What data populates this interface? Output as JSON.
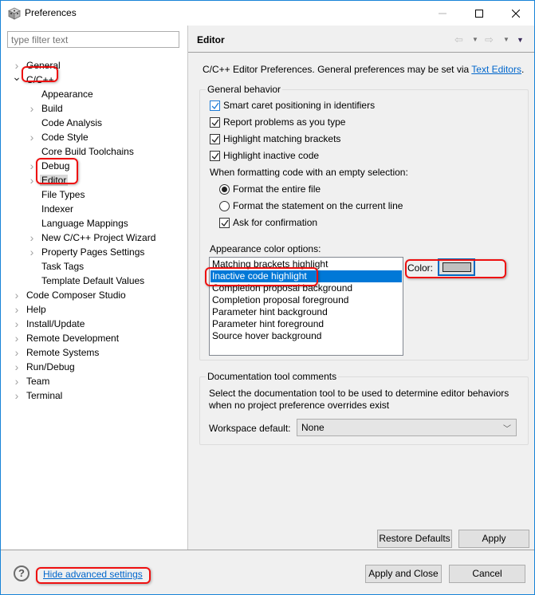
{
  "window": {
    "title": "Preferences",
    "icons": {
      "app": "preferences-app-icon",
      "minimize": "minimize-icon",
      "maximize": "maximize-icon",
      "close": "close-icon"
    }
  },
  "filter": {
    "placeholder": "type filter text",
    "value": ""
  },
  "tree": [
    {
      "label": "General",
      "level": 0,
      "twisty": "collapsed"
    },
    {
      "label": "C/C++",
      "level": 0,
      "twisty": "expanded",
      "annotated": true
    },
    {
      "label": "Appearance",
      "level": 1,
      "twisty": "none"
    },
    {
      "label": "Build",
      "level": 1,
      "twisty": "collapsed"
    },
    {
      "label": "Code Analysis",
      "level": 1,
      "twisty": "none"
    },
    {
      "label": "Code Style",
      "level": 1,
      "twisty": "collapsed"
    },
    {
      "label": "Core Build Toolchains",
      "level": 1,
      "twisty": "none"
    },
    {
      "label": "Debug",
      "level": 1,
      "twisty": "collapsed"
    },
    {
      "label": "Editor",
      "level": 1,
      "twisty": "collapsed",
      "selected": true,
      "annotated": true
    },
    {
      "label": "File Types",
      "level": 1,
      "twisty": "none"
    },
    {
      "label": "Indexer",
      "level": 1,
      "twisty": "none"
    },
    {
      "label": "Language Mappings",
      "level": 1,
      "twisty": "none"
    },
    {
      "label": "New C/C++ Project Wizard",
      "level": 1,
      "twisty": "collapsed"
    },
    {
      "label": "Property Pages Settings",
      "level": 1,
      "twisty": "collapsed"
    },
    {
      "label": "Task Tags",
      "level": 1,
      "twisty": "none"
    },
    {
      "label": "Template Default Values",
      "level": 1,
      "twisty": "none"
    },
    {
      "label": "Code Composer Studio",
      "level": 0,
      "twisty": "collapsed"
    },
    {
      "label": "Help",
      "level": 0,
      "twisty": "collapsed"
    },
    {
      "label": "Install/Update",
      "level": 0,
      "twisty": "collapsed"
    },
    {
      "label": "Remote Development",
      "level": 0,
      "twisty": "collapsed"
    },
    {
      "label": "Remote Systems",
      "level": 0,
      "twisty": "collapsed"
    },
    {
      "label": "Run/Debug",
      "level": 0,
      "twisty": "collapsed"
    },
    {
      "label": "Team",
      "level": 0,
      "twisty": "collapsed"
    },
    {
      "label": "Terminal",
      "level": 0,
      "twisty": "collapsed"
    }
  ],
  "page": {
    "title": "Editor",
    "nav": {
      "back": "back-arrow-icon",
      "forward": "forward-arrow-icon",
      "menu": "view-menu-icon"
    },
    "description_prefix": "C/C++ Editor Preferences. General preferences may be set via ",
    "description_link": "Text Editors",
    "description_suffix": ".",
    "general_behavior": {
      "legend": "General behavior",
      "checkboxes": [
        {
          "label": "Smart caret positioning in identifiers",
          "checked": true,
          "focused": true
        },
        {
          "label": "Report problems as you type",
          "checked": true
        },
        {
          "label": "Highlight matching brackets",
          "checked": true
        },
        {
          "label": "Highlight inactive code",
          "checked": true
        }
      ],
      "format_label": "When formatting code with an empty selection:",
      "radios": [
        {
          "label": "Format the entire file",
          "selected": true
        },
        {
          "label": "Format the statement on the current line",
          "selected": false
        }
      ],
      "confirm": {
        "label": "Ask for confirmation",
        "checked": true
      },
      "appearance_label": "Appearance color options:",
      "color_options": [
        "Matching brackets highlight",
        "Inactive code highlight",
        "Completion proposal background",
        "Completion proposal foreground",
        "Parameter hint background",
        "Parameter hint foreground",
        "Source hover background"
      ],
      "selected_color_option": "Inactive code highlight",
      "color_label": "Color:",
      "color_value": "#c0c0c0"
    },
    "doc_tool": {
      "legend": "Documentation tool comments",
      "description_line1": "Select the documentation tool to be used to determine editor behaviors",
      "description_line2": "when no project preference overrides exist",
      "workspace_label": "Workspace default:",
      "workspace_value": "None"
    },
    "buttons": {
      "restore_defaults": "Restore Defaults",
      "apply": "Apply"
    }
  },
  "footer": {
    "help_icon": "help-icon",
    "hide_link": "Hide advanced settings",
    "apply_close": "Apply and Close",
    "cancel": "Cancel"
  },
  "colors": {
    "selection": "#0078d7",
    "link": "#0066cc",
    "annotation": "#ee1010",
    "focus": "#0067c0"
  }
}
